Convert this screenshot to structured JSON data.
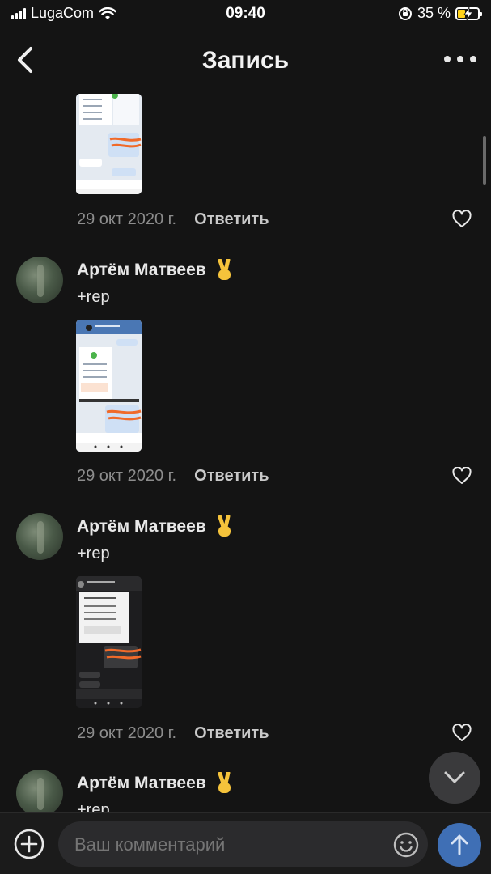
{
  "status_bar": {
    "carrier": "LugaCom",
    "time": "09:40",
    "battery": "35 %",
    "battery_level": 0.35
  },
  "header": {
    "title": "Запись",
    "back_icon": "chevron-left-icon",
    "more_icon": "more-horizontal-icon"
  },
  "comments": [
    {
      "author": "",
      "text": "",
      "date": "29 окт 2020 г.",
      "reply_label": "Ответить"
    },
    {
      "author": "Артём Матвеев",
      "text": "+rep",
      "date": "29 окт 2020 г.",
      "reply_label": "Ответить"
    },
    {
      "author": "Артём Матвеев",
      "text": "+rep",
      "date": "29 окт 2020 г.",
      "reply_label": "Ответить"
    },
    {
      "author": "Артём Матвеев",
      "text": "+rep"
    }
  ],
  "composer": {
    "placeholder": "Ваш комментарий"
  },
  "colors": {
    "background": "#141414",
    "accent": "#3f6fb5",
    "muted": "#8d8d8d"
  }
}
